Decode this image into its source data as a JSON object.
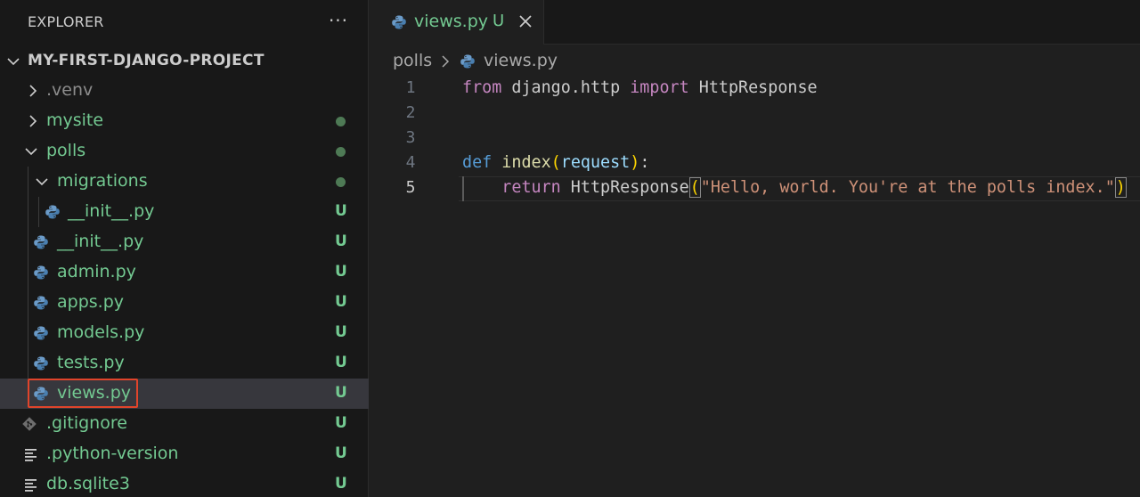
{
  "sidebar": {
    "title": "EXPLORER",
    "more_label": "···",
    "project": "MY-FIRST-DJANGO-PROJECT",
    "items": [
      {
        "label": ".venv",
        "badge": ""
      },
      {
        "label": "mysite",
        "badge": ""
      },
      {
        "label": "polls",
        "badge": ""
      },
      {
        "label": "migrations",
        "badge": ""
      },
      {
        "label": "__init__.py",
        "badge": "U"
      },
      {
        "label": "__init__.py",
        "badge": "U"
      },
      {
        "label": "admin.py",
        "badge": "U"
      },
      {
        "label": "apps.py",
        "badge": "U"
      },
      {
        "label": "models.py",
        "badge": "U"
      },
      {
        "label": "tests.py",
        "badge": "U"
      },
      {
        "label": "views.py",
        "badge": "U"
      },
      {
        "label": ".gitignore",
        "badge": "U"
      },
      {
        "label": ".python-version",
        "badge": "U"
      },
      {
        "label": "db.sqlite3",
        "badge": "U"
      }
    ]
  },
  "editor": {
    "tab": {
      "label": "views.py",
      "badge": "U"
    },
    "breadcrumb": [
      "polls",
      "views.py"
    ],
    "line_numbers": [
      "1",
      "2",
      "3",
      "4",
      "5"
    ],
    "code": {
      "l1_from": "from",
      "l1_module": " django.http ",
      "l1_import": "import",
      "l1_name": " HttpResponse",
      "l4_def": "def",
      "l4_fn": "index",
      "l4_open": "(",
      "l4_param": "request",
      "l4_close": ")",
      "l4_colon": ":",
      "l5_indent": "    ",
      "l5_return": "return",
      "l5_call": " HttpResponse",
      "l5_open": "(",
      "l5_string": "\"Hello, world. You're at the polls index.\"",
      "l5_close": ")"
    }
  },
  "colors": {
    "untracked": "#73c991",
    "modified_dot": "#4e7a55",
    "highlight_box": "#e0442b",
    "selected_row": "#37373d"
  },
  "icons": {
    "python": "python-icon",
    "git": "git-icon",
    "text": "text-file-icon",
    "chevron_right": "chevron-right-icon",
    "chevron_down": "chevron-down-icon",
    "close": "close-icon"
  }
}
